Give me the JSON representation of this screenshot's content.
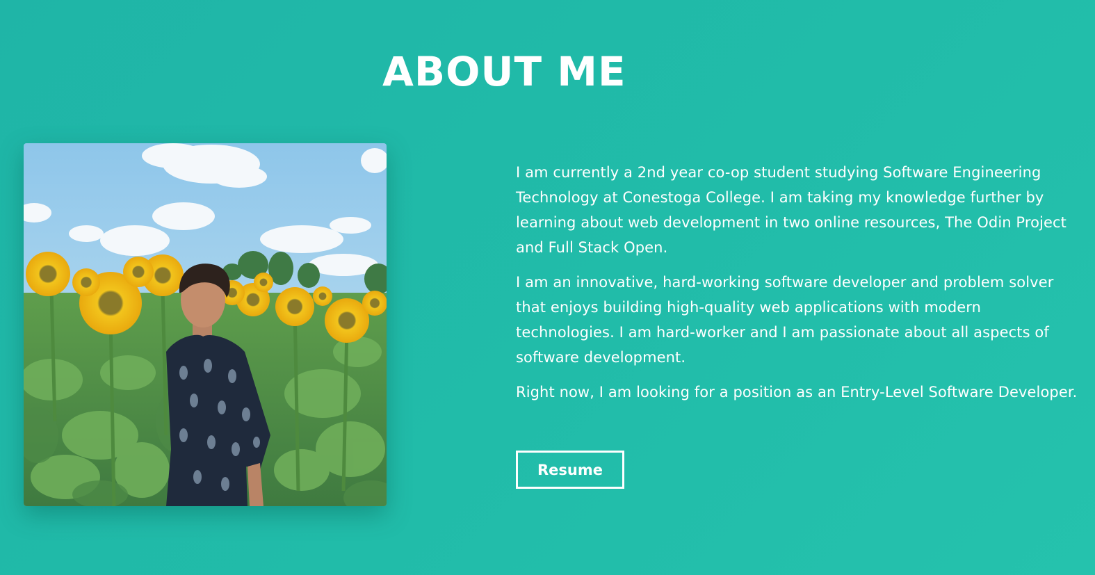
{
  "about": {
    "title": "ABOUT ME",
    "paragraphs": [
      "I am currently a 2nd year co-op student studying Software Engineering Technology at Conestoga College. I am taking my knowledge further by learning about web development in two online resources, The Odin Project and Full Stack Open.",
      "I am an innovative, hard-working software developer and problem solver that enjoys building high-quality web applications with modern technologies. I am hard-worker and I am passionate about all aspects of software development.",
      "Right now, I am looking for a position as an Entry-Level Software Developer."
    ],
    "resume_label": "Resume"
  },
  "colors": {
    "background": "#21bca9",
    "text": "#ffffff"
  }
}
